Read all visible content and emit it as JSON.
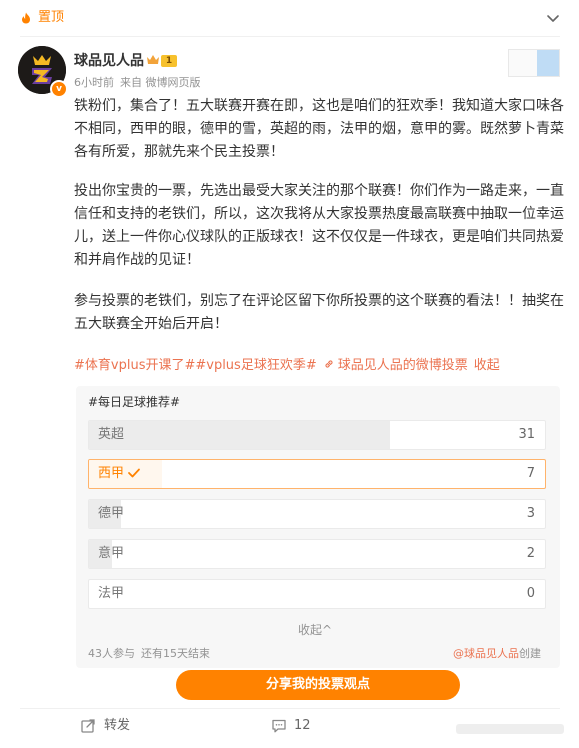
{
  "pin": {
    "label": "置顶",
    "icon": "flame-icon",
    "collapse_icon": "chevron-down-icon"
  },
  "author": {
    "name": "球品见人品",
    "time": "6小时前",
    "source": "来自 微博网页版",
    "member_tag": "1",
    "avatar_icon": "user-avatar",
    "verified_icon": "verified-badge-icon"
  },
  "body": {
    "paragraphs": [
      "铁粉们，集合了！五大联赛开赛在即，这也是咱们的狂欢季！我知道大家口味各不相同，西甲的眼，德甲的雪，英超的雨，法甲的烟，意甲的雾。既然萝卜青菜各有所爱，那就先来个民主投票！",
      "投出你宝贵的一票，先选出最受大家关注的那个联赛！你们作为一路走来，一直信任和支持的老铁们，所以，这次我将从大家投票热度最高联赛中抽取一位幸运儿，送上一件你心仪球队的正版球衣！这不仅仅是一件球衣，更是咱们共同热爱和并肩作战的见证！",
      "参与投票的老铁们，别忘了在评论区留下你所投票的这个联赛的看法！！抽奖在五大联赛全开始后开启！"
    ],
    "topics": [
      "#体育vplus开课了#",
      "#vplus足球狂欢季#"
    ],
    "vote_link": "球品见人品的微博投票",
    "fold_text": "收起"
  },
  "vote": {
    "title": "#每日足球推荐#",
    "options": [
      {
        "label": "英超",
        "count": "31",
        "share": 0.66,
        "selected": false
      },
      {
        "label": "西甲",
        "count": "7",
        "share": 0.16,
        "selected": true
      },
      {
        "label": "德甲",
        "count": "3",
        "share": 0.07,
        "selected": false
      },
      {
        "label": "意甲",
        "count": "2",
        "share": 0.05,
        "selected": false
      },
      {
        "label": "法甲",
        "count": "0",
        "share": 0.0,
        "selected": false
      }
    ],
    "collapse": "收起^",
    "participants": "43人参与",
    "remaining": "还有15天结束",
    "creator": "@球品见人品",
    "creator_suffix": "创建",
    "share_button": "分享我的投票观点"
  },
  "actions": {
    "repost": "转发",
    "comment_count": "12"
  },
  "colors": {
    "accent": "#ff8200",
    "link": "#eb7350",
    "muted": "#939393"
  }
}
